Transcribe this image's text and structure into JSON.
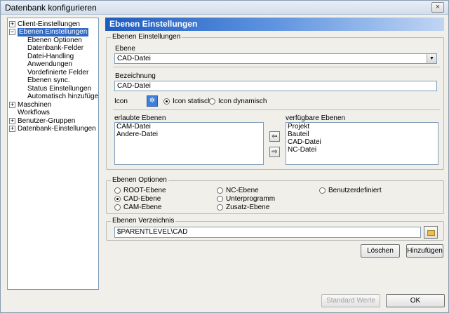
{
  "window": {
    "title": "Datenbank konfigurieren",
    "close_label": "×"
  },
  "tree": {
    "items": [
      {
        "label": "Client-Einstellungen",
        "expander": "+",
        "level": 0,
        "selected": false
      },
      {
        "label": "Ebenen Einstellungen",
        "expander": "−",
        "level": 0,
        "selected": true
      },
      {
        "label": "Ebenen Optionen",
        "level": 1,
        "selected": false
      },
      {
        "label": "Datenbank-Felder",
        "level": 1,
        "selected": false
      },
      {
        "label": "Datei-Handling",
        "level": 1,
        "selected": false
      },
      {
        "label": "Anwendungen",
        "level": 1,
        "selected": false
      },
      {
        "label": "Vordefinierte Felder",
        "level": 1,
        "selected": false
      },
      {
        "label": "Ebenen sync.",
        "level": 1,
        "selected": false
      },
      {
        "label": "Status Einstellungen",
        "level": 1,
        "selected": false
      },
      {
        "label": "Automatisch hinzufügen",
        "level": 1,
        "selected": false
      },
      {
        "label": "Maschinen",
        "expander": "+",
        "level": 0,
        "selected": false
      },
      {
        "label": "Workflows",
        "level": 0,
        "selected": false
      },
      {
        "label": "Benutzer-Gruppen",
        "expander": "+",
        "level": 0,
        "selected": false
      },
      {
        "label": "Datenbank-Einstellungen",
        "expander": "+",
        "level": 0,
        "selected": false
      }
    ]
  },
  "panel": {
    "header": "Ebenen Einstellungen",
    "settings_group": "Ebenen Einstellungen",
    "ebene_label": "Ebene",
    "ebene_value": "CAD-Datei",
    "bezeichnung_label": "Bezeichnung",
    "bezeichnung_value": "CAD-Datei",
    "icon_label": "Icon",
    "icon_static": "Icon statisch",
    "icon_dynamic": "Icon dynamisch",
    "allowed_label": "erlaubte Ebenen",
    "allowed_items": [
      "CAM-Datei",
      "Andere-Datei"
    ],
    "available_label": "verfügbare Ebenen",
    "available_items": [
      "Projekt",
      "Bauteil",
      "CAD-Datei",
      "NC-Datei"
    ],
    "arrow_left": "⇦",
    "arrow_right": "⇨"
  },
  "options": {
    "group": "Ebenen Optionen",
    "items": [
      "ROOT-Ebene",
      "CAD-Ebene",
      "CAM-Ebene",
      "NC-Ebene",
      "Unterprogramm",
      "Zusatz-Ebene",
      "Benutzerdefiniert"
    ],
    "selected": "CAD-Ebene"
  },
  "directory": {
    "group": "Ebenen Verzeichnis",
    "value": "$PARENTLEVEL\\CAD"
  },
  "buttons": {
    "delete": "Löschen",
    "add": "Hinzufügen",
    "defaults": "Standard Werte",
    "ok": "OK"
  },
  "icons": {
    "layer_icon": "layer-icon",
    "folder": "folder-icon"
  }
}
